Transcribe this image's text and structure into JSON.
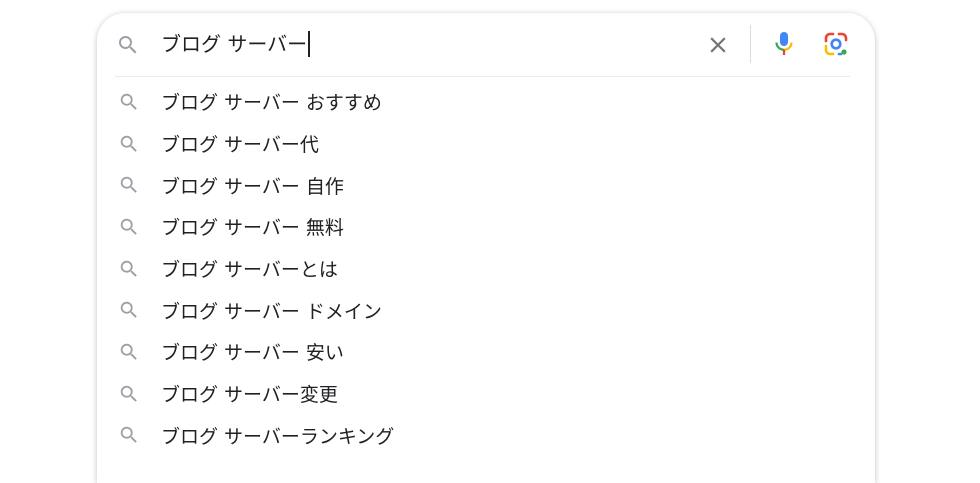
{
  "search": {
    "query": "ブログ サーバー",
    "suggestions": [
      "ブログ サーバー おすすめ",
      "ブログ サーバー代",
      "ブログ サーバー 自作",
      "ブログ サーバー 無料",
      "ブログ サーバーとは",
      "ブログ サーバー ドメイン",
      "ブログ サーバー 安い",
      "ブログ サーバー変更",
      "ブログ サーバーランキング"
    ]
  },
  "icons": {
    "search": "search-icon",
    "clear": "close-icon",
    "voice": "microphone-icon",
    "lens": "google-lens-icon"
  },
  "colors": {
    "text": "#202124",
    "icon_gray": "#9aa0a6",
    "clear_gray": "#70757a",
    "google_blue": "#4285f4",
    "google_red": "#ea4335",
    "google_yellow": "#fbbc04",
    "google_green": "#34a853"
  }
}
